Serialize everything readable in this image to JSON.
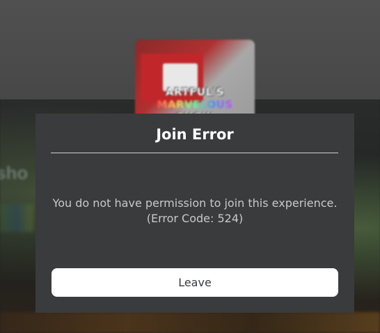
{
  "background": {
    "thumbnail": {
      "logo_line1_start": "ARTFUL'S ",
      "logo_line1_highlight": "MARVELOUS",
      "logo_line2": "SHOW"
    },
    "side_text": "sho"
  },
  "dialog": {
    "title": "Join Error",
    "message_line1": "You do not have permission to join this experience.",
    "message_line2": "(Error Code: 524)",
    "leave_label": "Leave"
  },
  "colors": {
    "dialog_bg": "#393b3d",
    "button_bg": "#ffffff",
    "title_text": "#ffffff",
    "message_text": "#c8c9ca"
  }
}
